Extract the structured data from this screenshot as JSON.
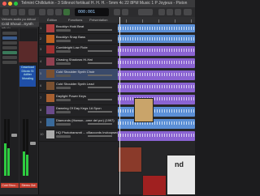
{
  "window": {
    "title": "Telmint  Chilldurkin  - 3  Stlinnot  fortikusl  H. H. H.  - 5mm 4c 22 8PM  Music  1  P  Joyjeus - Piston"
  },
  "toolbar": {
    "lcd": "000:001"
  },
  "inspector": {
    "header": "Velours audio pu ddtool",
    "track_name": "Cold Shoud...Synth Choir",
    "channel_left": "Cold Shou...",
    "channel_right": "Stereo Out",
    "label_text": "Download Ditonic SI Adliter Mussiing"
  },
  "track_list": {
    "tabs": [
      "Édition",
      "Fonctions",
      "Présentation"
    ],
    "tracks": [
      {
        "num": "1",
        "name": "Brooklyn Hold Beat",
        "thumb_color": "#b04040"
      },
      {
        "num": "2",
        "name": "Brooklyn Snap Bass",
        "thumb_color": "#c06020"
      },
      {
        "num": "3",
        "name": "Combleight Low Flute",
        "thumb_color": "#a03030"
      },
      {
        "num": "4",
        "name": "Chasing Shadows Hi-Hat",
        "thumb_color": "#904050"
      },
      {
        "num": "5",
        "name": "Cold Shoulder Synth Choir",
        "thumb_color": "#7a5030"
      },
      {
        "num": "6",
        "name": "Cold Shoulder Synth Lead",
        "thumb_color": "#7a5030"
      },
      {
        "num": "7",
        "name": "Daylight Power Keys",
        "thumb_color": "#a86030"
      },
      {
        "num": "8",
        "name": "Dawning Of Day Kegs 1A Spon",
        "thumb_color": "#6a4a8a"
      },
      {
        "num": "9",
        "name": "Diamonds (Hamon...ome del pcr) (1997)",
        "thumb_color": "#3a6a9a"
      },
      {
        "num": "10",
        "name": "HQ Phototransmit ... cBaccords Invloopsed",
        "thumb_color": "#aaa"
      }
    ]
  },
  "arrange": {
    "region_colors": {
      "blue": "#5b8fd6",
      "purple": "#8a63d2"
    },
    "art_label": "nd"
  }
}
